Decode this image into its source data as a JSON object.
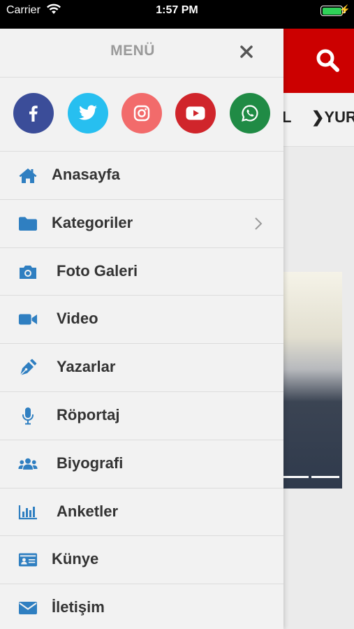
{
  "status_bar": {
    "carrier": "Carrier",
    "time": "1:57 PM",
    "battery_level": 1.0
  },
  "background_app": {
    "header_color": "#cc0000",
    "nav_partial": "L",
    "nav_item": "❯YURT"
  },
  "drawer": {
    "title": "MENÜ",
    "social": [
      {
        "name": "facebook-icon",
        "color": "#3b4d99"
      },
      {
        "name": "twitter-icon",
        "color": "#27bff0"
      },
      {
        "name": "instagram-icon",
        "color": "#f26b6b"
      },
      {
        "name": "youtube-icon",
        "color": "#d0252b"
      },
      {
        "name": "whatsapp-icon",
        "color": "#208b45"
      }
    ],
    "items": [
      {
        "label": "Anasayfa",
        "icon": "home-icon"
      },
      {
        "label": "Kategoriler",
        "icon": "folder-icon"
      },
      {
        "label": "Foto Galeri",
        "icon": "camera-icon"
      },
      {
        "label": "Video",
        "icon": "video-camera-icon"
      },
      {
        "label": "Yazarlar",
        "icon": "pen-icon"
      },
      {
        "label": "Röportaj",
        "icon": "microphone-icon"
      },
      {
        "label": "Biyografi",
        "icon": "users-icon"
      },
      {
        "label": "Anketler",
        "icon": "bar-chart-icon"
      },
      {
        "label": "Künye",
        "icon": "id-card-icon"
      },
      {
        "label": "İletişim",
        "icon": "envelope-icon"
      }
    ],
    "icon_color": "#2f7fc1"
  }
}
